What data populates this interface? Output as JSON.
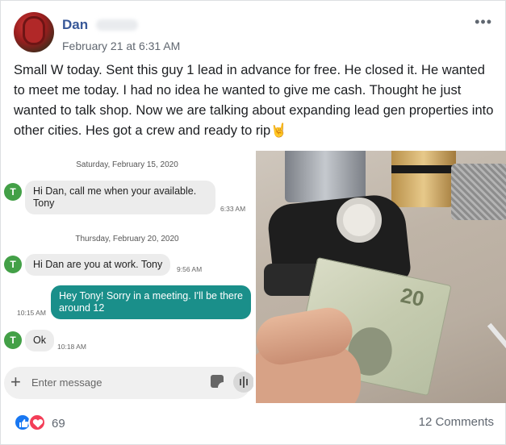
{
  "post": {
    "author": "Dan",
    "timestamp": "February 21 at 6:31 AM",
    "more_label": "•••",
    "text": "Small W today. Sent this guy 1 lead in advance for free. He closed it. He wanted to meet me today. I had no idea he wanted to give me cash. Thought he just wanted to talk shop. Now we are talking about expanding lead gen properties into other cities. Hes got a crew and ready to rip🤘"
  },
  "screenshot": {
    "date1": "Saturday, February 15, 2020",
    "msg1": {
      "avatar": "T",
      "text_line1": "Hi Dan, call me when your available.",
      "text_line2": "Tony",
      "time": "6:33 AM"
    },
    "date2": "Thursday, February 20, 2020",
    "msg2": {
      "avatar": "T",
      "text": "Hi Dan are you at work. Tony",
      "time": "9:56 AM"
    },
    "msg3": {
      "text_line1": "Hey Tony! Sorry in a meeting. I'll be there",
      "text_line2": "around 12",
      "time": "10:15 AM"
    },
    "msg4": {
      "avatar": "T",
      "text": "Ok",
      "time": "10:18 AM"
    },
    "composer_placeholder": "Enter message",
    "plus_icon": "+"
  },
  "photo": {
    "bill_value": "20"
  },
  "footer": {
    "reaction_count": "69",
    "comments": "12 Comments"
  },
  "colors": {
    "author": "#385898",
    "avatar_green": "#43a047",
    "outgoing_bubble": "#1a8f8a",
    "like": "#1877f2",
    "love": "#f33e58"
  },
  "icons": [
    "more-options-icon",
    "plus-icon",
    "sticker-icon",
    "voice-icon",
    "like-reaction-icon",
    "love-reaction-icon"
  ]
}
